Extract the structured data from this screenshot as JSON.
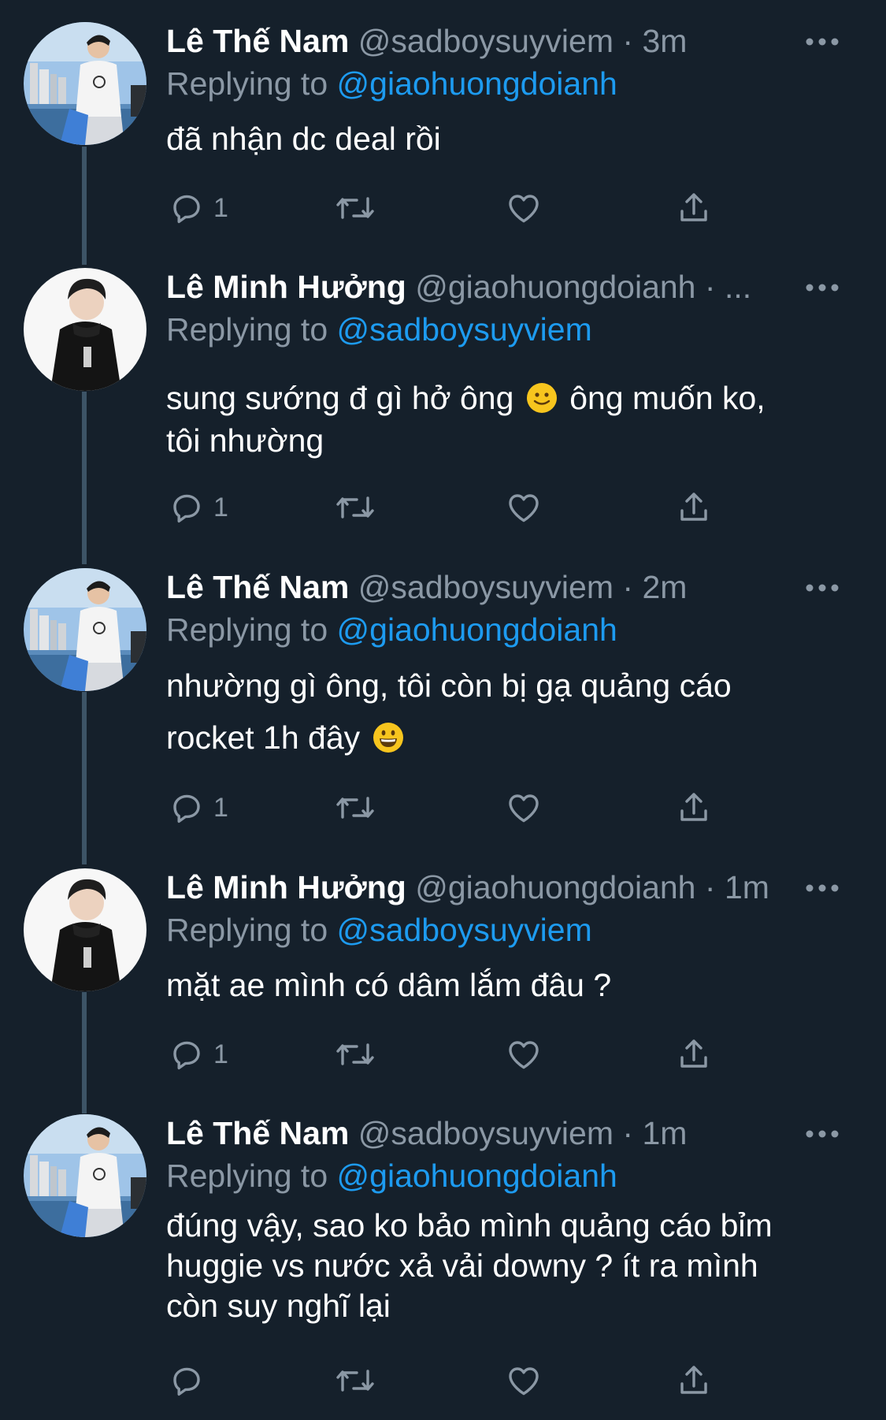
{
  "colors": {
    "background": "#15202b",
    "secondary_text": "#8b98a5",
    "mention": "#1d9bf0",
    "thread_line": "#3d5466"
  },
  "tweets": [
    {
      "author": "Lê Thế Nam",
      "handle": "@sadboysuyviem",
      "separator": "·",
      "time": "3m",
      "replying_label": "Replying to",
      "replying_handle": "@giaohuongdoianh",
      "lines": [
        "đã nhận dc deal rồi"
      ],
      "reply_count": "1",
      "avatar": "avatar-photo-man-waterfront"
    },
    {
      "author": "Lê Minh Hưởng",
      "handle": "@giaohuongdoianh",
      "separator": "·",
      "time": "...",
      "replying_label": "Replying to",
      "replying_handle": "@sadboysuyviem",
      "text_before_emoji": "sung sướng đ gì hở ông",
      "emoji": "slightly-smiling-face-emoji",
      "text_after_emoji": "ông muốn ko,",
      "line2": "tôi nhường",
      "reply_count": "1",
      "avatar": "avatar-photo-man-black-hoodie"
    },
    {
      "author": "Lê Thế Nam",
      "handle": "@sadboysuyviem",
      "separator": "·",
      "time": "2m",
      "replying_label": "Replying to",
      "replying_handle": "@giaohuongdoianh",
      "line1": "nhường gì ông, tôi còn bị gạ quảng cáo",
      "line2_before_emoji": "rocket 1h đây",
      "emoji": "grinning-face-emoji",
      "reply_count": "1",
      "avatar": "avatar-photo-man-waterfront"
    },
    {
      "author": "Lê Minh Hưởng",
      "handle": "@giaohuongdoianh",
      "separator": "·",
      "time": "1m",
      "replying_label": "Replying to",
      "replying_handle": "@sadboysuyviem",
      "lines": [
        "mặt ae mình có dâm lắm đâu ?"
      ],
      "reply_count": "1",
      "avatar": "avatar-photo-man-black-hoodie"
    },
    {
      "author": "Lê Thế Nam",
      "handle": "@sadboysuyviem",
      "separator": "·",
      "time": "1m",
      "replying_label": "Replying to",
      "replying_handle": "@giaohuongdoianh",
      "lines": [
        "đúng vậy, sao ko bảo mình quảng cáo bỉm",
        "huggie vs nước xả vải downy ? ít ra mình",
        "còn suy nghĩ lại"
      ],
      "reply_count": "",
      "avatar": "avatar-photo-man-waterfront"
    }
  ],
  "action_icons": [
    "reply-icon",
    "retweet-icon",
    "like-icon",
    "share-icon"
  ],
  "more_icon": "more-options-icon"
}
